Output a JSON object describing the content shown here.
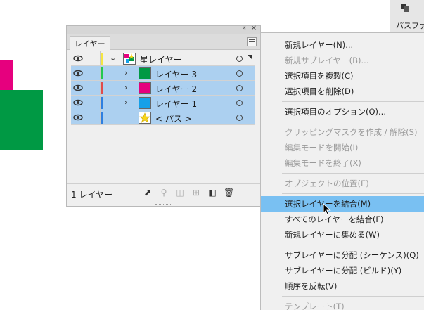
{
  "canvas": {
    "colors": {
      "pink": "#e6007e",
      "green": "#009944"
    }
  },
  "side_panel": {
    "label": "パスファ",
    "icon": "pathfinder-icon"
  },
  "layers_panel": {
    "tab_label": "レイヤー",
    "collapse_glyph": "«",
    "close_glyph": "✕",
    "rows": [
      {
        "name": "星レイヤー",
        "color": "#f5e642",
        "expanded": true,
        "selected": false,
        "thumb": "multi"
      },
      {
        "name": "レイヤー 3",
        "color": "#23c94e",
        "expanded": false,
        "selected": true,
        "thumb": "#009944"
      },
      {
        "name": "レイヤー 2",
        "color": "#e14b4b",
        "expanded": false,
        "selected": true,
        "thumb": "#e6007e"
      },
      {
        "name": "レイヤー 1",
        "color": "#2e7fe0",
        "expanded": false,
        "selected": true,
        "thumb": "#16a0e8"
      },
      {
        "name": "< パス >",
        "color": "#2e7fe0",
        "expanded": false,
        "selected": true,
        "thumb": "star"
      }
    ],
    "footer_count": "1 レイヤー",
    "footer_icons": [
      "export-icon",
      "search-icon",
      "clipping-mask-icon",
      "sublayer-icon",
      "new-layer-icon",
      "trash-icon"
    ]
  },
  "context_menu": {
    "items": [
      {
        "label": "新規レイヤー(N)...",
        "disabled": false
      },
      {
        "label": "新規サブレイヤー(B)...",
        "disabled": true
      },
      {
        "label": "選択項目を複製(C)",
        "disabled": false
      },
      {
        "label": "選択項目を削除(D)",
        "disabled": false
      },
      {
        "label": "選択項目のオプション(O)...",
        "disabled": false
      },
      {
        "label": "クリッピングマスクを作成 / 解除(S)",
        "disabled": true
      },
      {
        "label": "編集モードを開始(I)",
        "disabled": true
      },
      {
        "label": "編集モードを終了(X)",
        "disabled": true
      },
      {
        "label": "オブジェクトの位置(E)",
        "disabled": true
      },
      {
        "label": "選択レイヤーを結合(M)",
        "disabled": false,
        "highlighted": true
      },
      {
        "label": "すべてのレイヤーを結合(F)",
        "disabled": false
      },
      {
        "label": "新規レイヤーに集める(W)",
        "disabled": false
      },
      {
        "label": "サブレイヤーに分配 (シーケンス)(Q)",
        "disabled": false
      },
      {
        "label": "サブレイヤーに分配 (ビルド)(Y)",
        "disabled": false
      },
      {
        "label": "順序を反転(V)",
        "disabled": false
      },
      {
        "label": "テンプレート(T)",
        "disabled": true
      }
    ]
  }
}
